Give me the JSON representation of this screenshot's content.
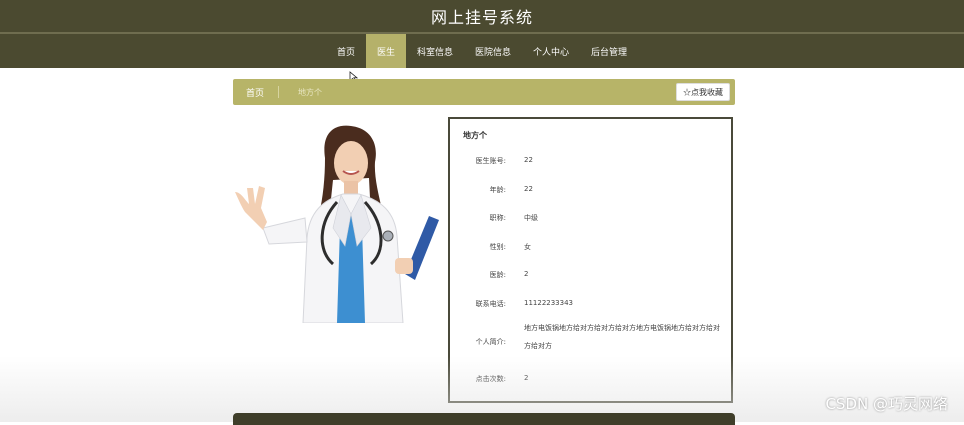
{
  "site": {
    "title": "网上挂号系统"
  },
  "nav": {
    "items": [
      {
        "label": "首页"
      },
      {
        "label": "医生"
      },
      {
        "label": "科室信息"
      },
      {
        "label": "医院信息"
      },
      {
        "label": "个人中心"
      },
      {
        "label": "后台管理"
      }
    ],
    "active_index": 1
  },
  "breadcrumb": {
    "home": "首页",
    "current": "地方个"
  },
  "favorite_button": {
    "label": "☆点我收藏"
  },
  "doctor": {
    "name": "地方个",
    "fields": [
      {
        "label": "医生账号:",
        "value": "22"
      },
      {
        "label": "年龄:",
        "value": "22"
      },
      {
        "label": "职称:",
        "value": "中级"
      },
      {
        "label": "性别:",
        "value": "女"
      },
      {
        "label": "医龄:",
        "value": "2"
      },
      {
        "label": "联系电话:",
        "value": "11122233343"
      },
      {
        "label": "个人简介:",
        "value": "地方电饭锅地方给对方给对方给对方地方电饭锅地方给对方给对方给对方"
      },
      {
        "label": "点击次数:",
        "value": "2"
      }
    ]
  },
  "watermark": "CSDN @巧灵网络",
  "colors": {
    "header_bg": "#4b4a30",
    "accent": "#b7b468",
    "nav_active": "#b5b16a"
  }
}
